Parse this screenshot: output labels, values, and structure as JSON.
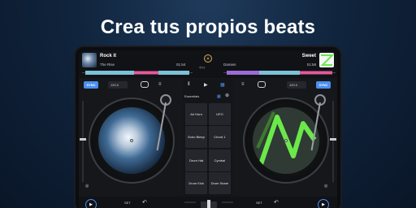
{
  "headline": "Crea tus propios beats",
  "deck_left": {
    "title": "Rock it",
    "artist": "The Rise",
    "time": "01:54",
    "bpm": "120.0",
    "sync_label": "SYNC"
  },
  "deck_right": {
    "title": "Sweet",
    "artist": "Damien",
    "time": "01:58",
    "bpm": "120.0",
    "sync_label": "SYNC"
  },
  "brand": "djay",
  "sampler": {
    "bank": "Essentials",
    "pads": [
      "Air Horn",
      "UFO",
      "Echo Bleep",
      "Chord 1",
      "Drum Hat",
      "Cymbal",
      "Drum Kick",
      "Drum Snare"
    ],
    "bpm": "124.0 BPM",
    "progress": 0.15
  },
  "bottombar": {
    "set_left": "SET",
    "set_right": "SET"
  },
  "colors": {
    "accent": "#4a8ff0",
    "background": "#10243d",
    "green": "#6be84a"
  },
  "icons": {
    "play": "play-icon",
    "loop": "loop-icon",
    "grid": "grid-icon",
    "headphones": "headphones-icon",
    "eq": "eq-icon"
  }
}
